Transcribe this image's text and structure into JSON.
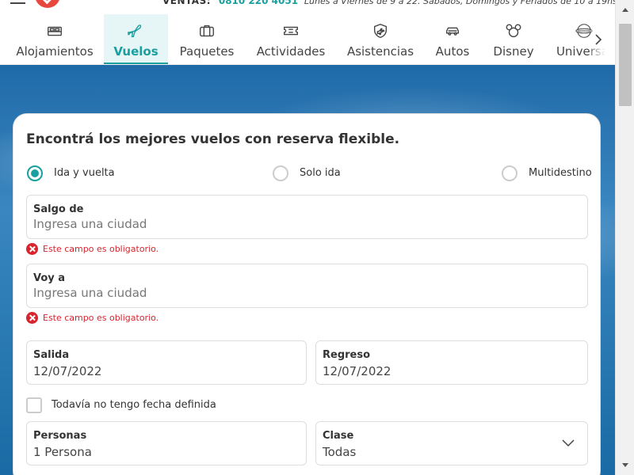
{
  "header": {
    "ventas_label": "VENTAS:",
    "phone": "0810 220 4051",
    "hours": "Lunes a Viernes de 9 a 22. Sábados, Domingos y Feriados de 10 a 19hs"
  },
  "tabs": [
    {
      "label": "Alojamientos",
      "icon": "bed-icon"
    },
    {
      "label": "Vuelos",
      "icon": "plane-icon",
      "active": true
    },
    {
      "label": "Paquetes",
      "icon": "suitcase-icon"
    },
    {
      "label": "Actividades",
      "icon": "ticket-icon"
    },
    {
      "label": "Asistencias",
      "icon": "shield-plane-icon"
    },
    {
      "label": "Autos",
      "icon": "car-icon"
    },
    {
      "label": "Disney",
      "icon": "mickey-icon"
    },
    {
      "label": "Universal",
      "icon": "universal-globe-icon"
    }
  ],
  "form": {
    "title": "Encontrá los mejores vuelos con reserva flexible.",
    "trip_types": [
      {
        "label": "Ida y vuelta",
        "checked": true
      },
      {
        "label": "Solo ida",
        "checked": false
      },
      {
        "label": "Multidestino",
        "checked": false
      }
    ],
    "origin": {
      "label": "Salgo de",
      "placeholder": "Ingresa una ciudad",
      "error": "Este campo es obligatorio."
    },
    "destination": {
      "label": "Voy a",
      "placeholder": "Ingresa una ciudad",
      "error": "Este campo es obligatorio."
    },
    "departure": {
      "label": "Salida",
      "value": "12/07/2022"
    },
    "return": {
      "label": "Regreso",
      "value": "12/07/2022"
    },
    "no_date": {
      "label": "Todavía no tengo fecha definida",
      "checked": false
    },
    "passengers": {
      "label": "Personas",
      "value": "1 Persona"
    },
    "cabin_class": {
      "label": "Clase",
      "value": "Todas"
    }
  },
  "colors": {
    "accent": "#1a9fa0",
    "error": "#d9232e",
    "brand": "#e8473f"
  }
}
